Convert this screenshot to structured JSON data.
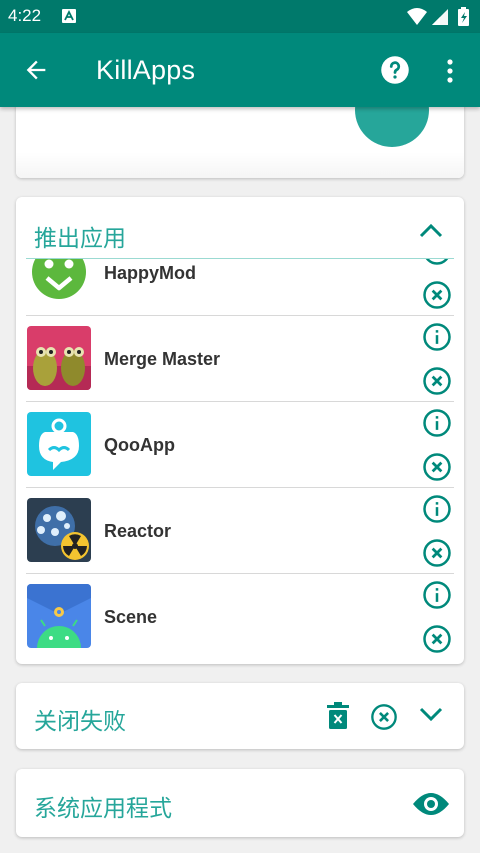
{
  "status_bar": {
    "time": "4:22"
  },
  "app_bar": {
    "title": "KillApps"
  },
  "sections": {
    "pushed": {
      "title": "推出应用"
    },
    "failed": {
      "title": "关闭失败"
    },
    "system": {
      "title": "系统应用程式"
    }
  },
  "apps": [
    {
      "name": "HappyMod",
      "icon": "happymod-app-icon"
    },
    {
      "name": "Merge Master",
      "icon": "merge-master-app-icon"
    },
    {
      "name": "QooApp",
      "icon": "qooapp-app-icon"
    },
    {
      "name": "Reactor",
      "icon": "reactor-app-icon"
    },
    {
      "name": "Scene",
      "icon": "scene-app-icon"
    }
  ],
  "colors": {
    "primary": "#00897b",
    "status_bar": "#00796b",
    "accent": "#26a69a",
    "icon_teal": "#00897b"
  }
}
